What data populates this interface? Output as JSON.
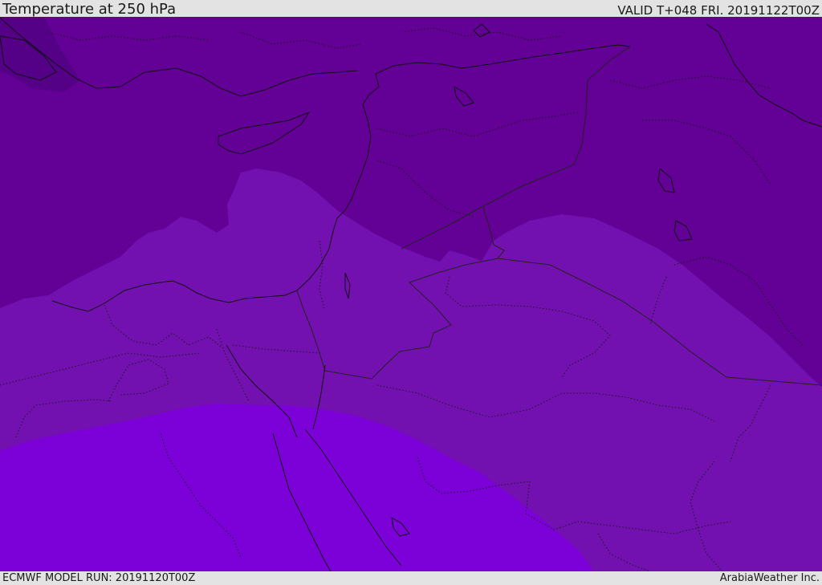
{
  "header": {
    "title": "Temperature at 250 hPa",
    "valid": "VALID T+048 FRI. 20191122T00Z"
  },
  "footer": {
    "model_run": "ECMWF MODEL RUN: 20191120T00Z",
    "credit": "ArabiaWeather Inc."
  },
  "map": {
    "variable": "temperature",
    "level": "250 hPa",
    "colors": {
      "band_darkest": "#540087",
      "band_dark": "#630096",
      "band_mid": "#7310b0",
      "band_light": "#7c00d8",
      "coastline": "#111111",
      "border": "#222222"
    }
  }
}
